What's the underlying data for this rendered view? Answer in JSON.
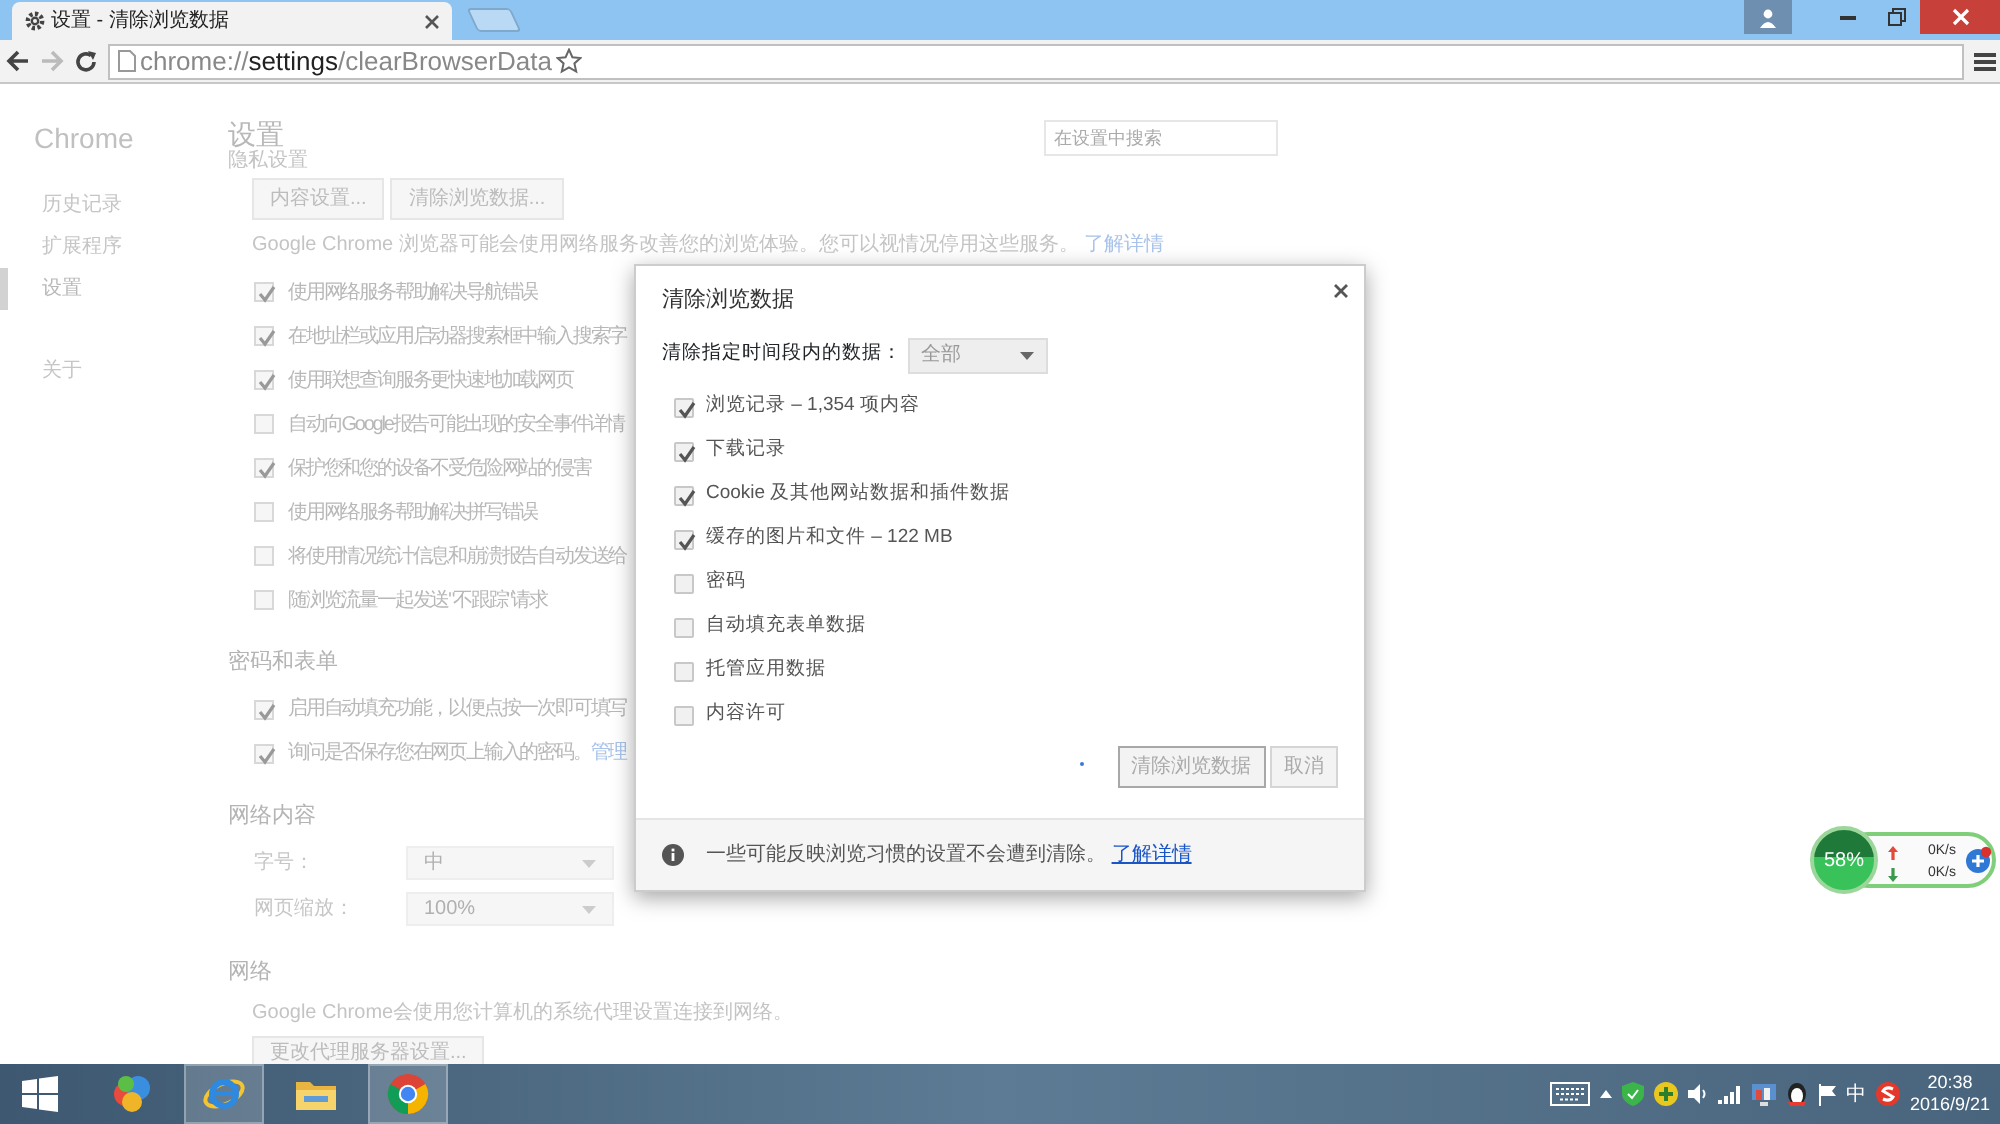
{
  "browser": {
    "tabs": [
      {
        "title": "设置 - 清除浏览数据",
        "selected": true
      }
    ],
    "address": "chrome://**settings**/clearBrowserData"
  },
  "sidebar": {
    "title": "Chrome",
    "items": [
      {
        "label": "历史记录",
        "selected": false
      },
      {
        "label": "扩展程序",
        "selected": false
      },
      {
        "label": "设置",
        "selected": true
      },
      {
        "label": "关于",
        "selected": false
      }
    ]
  },
  "settings": {
    "title": "设置",
    "search": {
      "placeholder": "在设置中搜索"
    },
    "privacy": {
      "heading": "隐私设置",
      "buttons": [
        "内容设置...",
        "清除浏览数据..."
      ],
      "note": "Google Chrome 浏览器可能会使用网络服务改善您的浏览体验。您可以视情况停用这些服务。",
      "note_link": "了解详情",
      "options": [
        {
          "label": "使用网络服务帮助解决导航错误",
          "checked": true
        },
        {
          "label": "在地址栏或应用启动器搜索框中输入搜索字",
          "checked": true
        },
        {
          "label": "使用联想查询服务更快速地加载网页",
          "checked": true
        },
        {
          "label": "自动向Google报告可能出现的安全事件详情",
          "checked": false
        },
        {
          "label": "保护您和您的设备不受危险网站的侵害",
          "checked": true
        },
        {
          "label": "使用网络服务帮助解决拼写错误",
          "checked": false
        },
        {
          "label": "将使用情况统计信息和崩溃报告自动发送给",
          "checked": false
        },
        {
          "label": "随浏览流量一起发送\"不跟踪\"请求",
          "checked": false
        }
      ]
    },
    "passwords": {
      "heading": "密码和表单",
      "options": [
        {
          "label": "启用自动填充功能，以便点按一次即可填写",
          "checked": true
        },
        {
          "label": "询问是否保存您在网页上输入的密码。",
          "checked": true,
          "link": "管理"
        }
      ]
    },
    "web_content": {
      "heading": "网络内容",
      "fields": [
        {
          "label": "字号：",
          "value": "中"
        },
        {
          "label": "网页缩放：",
          "value": "100%"
        }
      ]
    },
    "network": {
      "heading": "网络",
      "note": "Google Chrome会使用您计算机的系统代理设置连接到网络。",
      "button": "更改代理服务器设置..."
    }
  },
  "dialog": {
    "title": "清除浏览数据",
    "range_label": "清除指定时间段内的数据：",
    "range_value": "全部",
    "items": [
      {
        "label": "浏览记录 – 1,354 项内容",
        "checked": true
      },
      {
        "label": "下载记录",
        "checked": true
      },
      {
        "label": "Cookie 及其他网站数据和插件数据",
        "checked": true
      },
      {
        "label": "缓存的图片和文件 – 122 MB",
        "checked": true
      },
      {
        "label": "密码",
        "checked": false
      },
      {
        "label": "自动填充表单数据",
        "checked": false
      },
      {
        "label": "托管应用数据",
        "checked": false
      },
      {
        "label": "内容许可",
        "checked": false
      }
    ],
    "buttons": [
      "清除浏览数据",
      "取消"
    ],
    "footer": "一些可能反映浏览习惯的设置不会遭到清除。",
    "footer_link": "了解详情"
  },
  "network_monitor": {
    "reading": "58%",
    "upload": "0K/s",
    "download": "0K/s"
  },
  "taskbar": {
    "apps": [
      {
        "kind": "ball",
        "active": false
      },
      {
        "kind": "ie",
        "active": true
      },
      {
        "kind": "folder",
        "active": false
      },
      {
        "kind": "chrome",
        "active": true
      }
    ],
    "ime": "中",
    "time": "20:38",
    "date": "2016/9/21"
  }
}
